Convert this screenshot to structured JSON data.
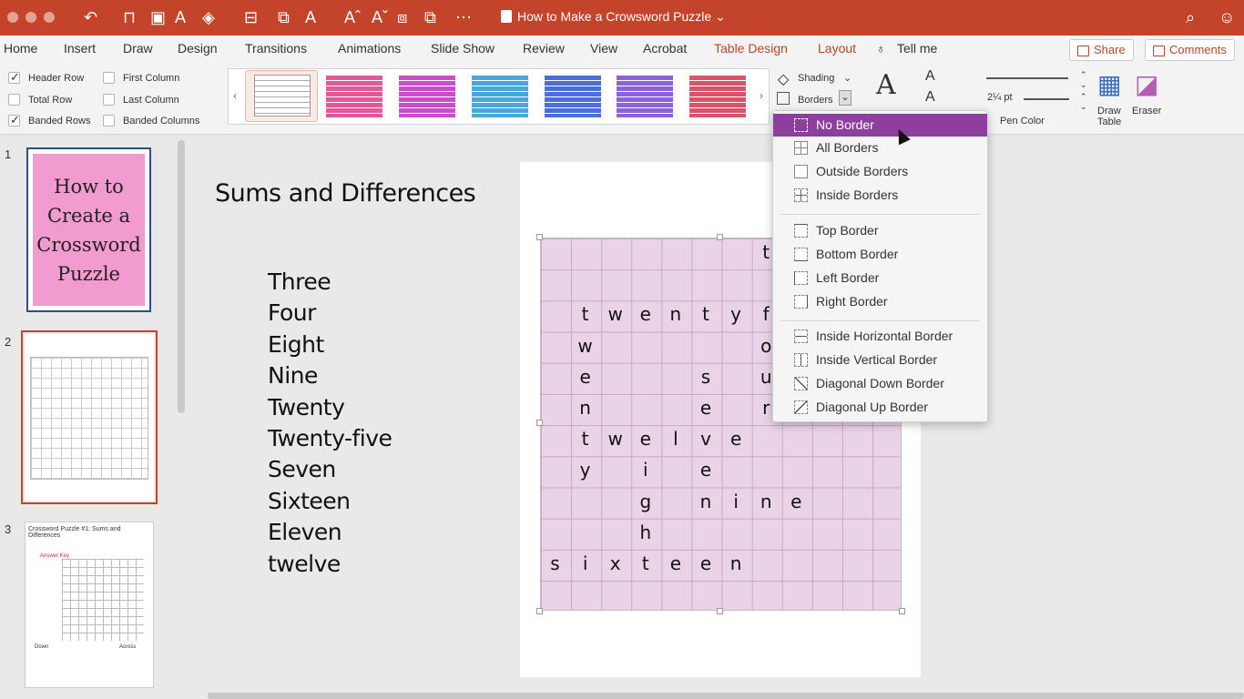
{
  "window": {
    "title": "How to Make a Crowsword Puzzle"
  },
  "tabs": [
    "Home",
    "Insert",
    "Draw",
    "Design",
    "Transitions",
    "Animations",
    "Slide Show",
    "Review",
    "View",
    "Acrobat",
    "Table Design",
    "Layout",
    "Tell me"
  ],
  "header": {
    "share": "Share",
    "comments": "Comments"
  },
  "options": {
    "header_row": "Header Row",
    "total_row": "Total Row",
    "banded_rows": "Banded Rows",
    "first_column": "First Column",
    "last_column": "Last Column",
    "banded_columns": "Banded Columns",
    "checked": {
      "header_row": true,
      "total_row": false,
      "banded_rows": true,
      "first_column": false,
      "last_column": false,
      "banded_columns": false
    }
  },
  "ribbon": {
    "shading": "Shading",
    "borders": "Borders",
    "pen_weight": "2¼ pt",
    "pen_color": "Pen Color",
    "draw_table_1": "Draw",
    "draw_table_2": "Table",
    "eraser": "Eraser",
    "style_colors": [
      "#e05a9a",
      "#c84fc7",
      "#49a7d9",
      "#4a6fd6",
      "#8b63d6",
      "#d9536b"
    ]
  },
  "borders_menu": [
    [
      "No Border",
      "All Borders",
      "Outside Borders",
      "Inside Borders"
    ],
    [
      "Top Border",
      "Bottom Border",
      "Left Border",
      "Right Border"
    ],
    [
      "Inside Horizontal Border",
      "Inside Vertical Border",
      "Diagonal Down Border",
      "Diagonal Up Border"
    ]
  ],
  "thumbnails": {
    "numbers": [
      "1",
      "2",
      "3"
    ],
    "slide1_text": "How to Create a Crossword Puzzle",
    "slide3_title": "Crossword Puzzle #1: Sums and Differences",
    "slide3_answer": "Answer Key",
    "slide3_down": "Down",
    "slide3_across": "Across"
  },
  "slide": {
    "title": "Sums and Differences",
    "words": [
      "Three",
      "Four",
      "Eight",
      "Nine",
      "Twenty",
      "Twenty-five",
      "Seven",
      "Sixteen",
      "Eleven",
      "twelve"
    ],
    "grid_letters": [
      {
        "r": 0,
        "c": 7,
        "ch": "t"
      },
      {
        "r": 2,
        "c": 1,
        "ch": "t"
      },
      {
        "r": 2,
        "c": 2,
        "ch": "w"
      },
      {
        "r": 2,
        "c": 3,
        "ch": "e"
      },
      {
        "r": 2,
        "c": 4,
        "ch": "n"
      },
      {
        "r": 2,
        "c": 5,
        "ch": "t"
      },
      {
        "r": 2,
        "c": 6,
        "ch": "y"
      },
      {
        "r": 2,
        "c": 7,
        "ch": "f"
      },
      {
        "r": 3,
        "c": 1,
        "ch": "w"
      },
      {
        "r": 3,
        "c": 7,
        "ch": "o"
      },
      {
        "r": 4,
        "c": 1,
        "ch": "e"
      },
      {
        "r": 4,
        "c": 5,
        "ch": "s"
      },
      {
        "r": 4,
        "c": 7,
        "ch": "u"
      },
      {
        "r": 5,
        "c": 1,
        "ch": "n"
      },
      {
        "r": 5,
        "c": 5,
        "ch": "e"
      },
      {
        "r": 5,
        "c": 7,
        "ch": "r"
      },
      {
        "r": 6,
        "c": 1,
        "ch": "t"
      },
      {
        "r": 6,
        "c": 2,
        "ch": "w"
      },
      {
        "r": 6,
        "c": 3,
        "ch": "e"
      },
      {
        "r": 6,
        "c": 4,
        "ch": "l"
      },
      {
        "r": 6,
        "c": 5,
        "ch": "v"
      },
      {
        "r": 6,
        "c": 6,
        "ch": "e"
      },
      {
        "r": 7,
        "c": 1,
        "ch": "y"
      },
      {
        "r": 7,
        "c": 3,
        "ch": "i"
      },
      {
        "r": 7,
        "c": 5,
        "ch": "e"
      },
      {
        "r": 8,
        "c": 3,
        "ch": "g"
      },
      {
        "r": 8,
        "c": 5,
        "ch": "n"
      },
      {
        "r": 8,
        "c": 6,
        "ch": "i"
      },
      {
        "r": 8,
        "c": 7,
        "ch": "n"
      },
      {
        "r": 8,
        "c": 8,
        "ch": "e"
      },
      {
        "r": 9,
        "c": 3,
        "ch": "h"
      },
      {
        "r": 10,
        "c": 0,
        "ch": "s"
      },
      {
        "r": 10,
        "c": 1,
        "ch": "i"
      },
      {
        "r": 10,
        "c": 2,
        "ch": "x"
      },
      {
        "r": 10,
        "c": 3,
        "ch": "t"
      },
      {
        "r": 10,
        "c": 4,
        "ch": "e"
      },
      {
        "r": 10,
        "c": 5,
        "ch": "e"
      },
      {
        "r": 10,
        "c": 6,
        "ch": "n"
      }
    ]
  },
  "colors": {
    "titlebar": "#c4432b",
    "accent": "#b7472a",
    "menu_highlight": "#8e3f9e",
    "grid_fill": "#ead3e7"
  }
}
